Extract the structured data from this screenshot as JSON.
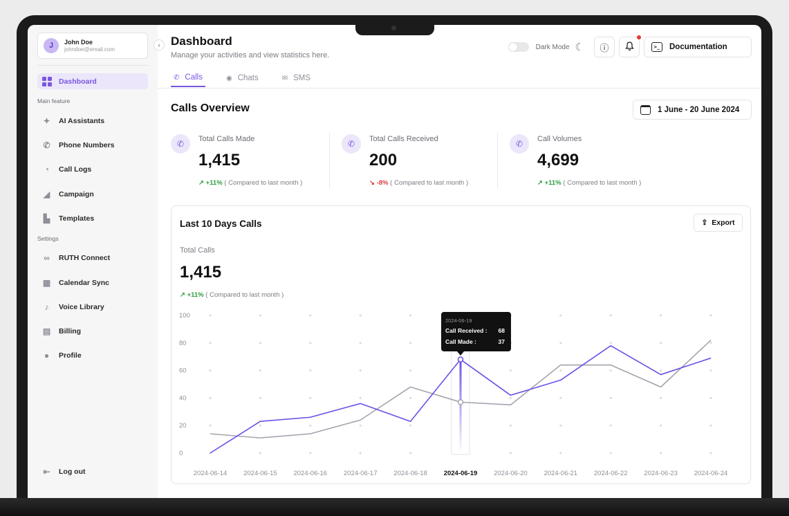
{
  "colors": {
    "accent": "#7a56e0",
    "accent_bg": "#ebe6fa",
    "up": "#2e9e3e",
    "down": "#d93a3a",
    "series_made": "#6c4ee6",
    "series_received": "#a3a3ad"
  },
  "user": {
    "initial": "J",
    "name": "John Doe",
    "email": "johndoe@email.com"
  },
  "sidebar": {
    "dashboard": "Dashboard",
    "main_label": "Main feature",
    "main_items": [
      {
        "label": "AI Assistants",
        "icon": "sparkle-icon"
      },
      {
        "label": "Phone Numbers",
        "icon": "phone-icon"
      },
      {
        "label": "Call Logs",
        "icon": "history-icon"
      },
      {
        "label": "Campaign",
        "icon": "megaphone-icon"
      },
      {
        "label": "Templates",
        "icon": "template-icon"
      }
    ],
    "settings_label": "Settings",
    "settings_items": [
      {
        "label": "RUTH Connect",
        "icon": "link-icon"
      },
      {
        "label": "Calendar Sync",
        "icon": "calendar-icon"
      },
      {
        "label": "Voice Library",
        "icon": "voice-icon"
      },
      {
        "label": "Billing",
        "icon": "billing-icon"
      },
      {
        "label": "Profile",
        "icon": "profile-icon"
      }
    ],
    "logout": "Log out"
  },
  "header": {
    "title": "Dashboard",
    "subtitle": "Manage your activities and view statistics here.",
    "dark_mode": "Dark Mode",
    "documentation": "Documentation"
  },
  "tabs": [
    "Calls",
    "Chats",
    "SMS"
  ],
  "overview": {
    "title": "Calls Overview",
    "date_range": "1 June - 20 June 2024",
    "stats": [
      {
        "label": "Total Calls Made",
        "value": "1,415",
        "change": "+11%",
        "direction": "up",
        "note": "( Compared to last month )"
      },
      {
        "label": "Total Calls Received",
        "value": "200",
        "change": "-8%",
        "direction": "down",
        "note": "( Compared to last month )"
      },
      {
        "label": "Call Volumes",
        "value": "4,699",
        "change": "+11%",
        "direction": "up",
        "note": "( Compared to last month )"
      }
    ]
  },
  "chart_card": {
    "title": "Last 10 Days Calls",
    "export": "Export",
    "total_label": "Total Calls",
    "total_value": "1,415",
    "total_change": "+11%",
    "total_note": "( Compared to last month )"
  },
  "chart_data": {
    "type": "line",
    "x": [
      "2024-06-14",
      "2024-06-15",
      "2024-06-16",
      "2024-06-17",
      "2024-06-18",
      "2024-06-19",
      "2024-06-20",
      "2024-06-21",
      "2024-06-22",
      "2024-06-23",
      "2024-06-24"
    ],
    "ylim": [
      0,
      100
    ],
    "yticks": [
      0,
      20,
      40,
      60,
      80,
      100
    ],
    "grid": "dots",
    "highlight_index": 5,
    "series": [
      {
        "key": "made",
        "values": [
          0,
          23,
          26,
          36,
          23,
          68,
          42,
          53,
          78,
          57,
          69
        ]
      },
      {
        "key": "received",
        "values": [
          14,
          11,
          14,
          24,
          48,
          37,
          35,
          64,
          64,
          48,
          82
        ]
      }
    ],
    "tooltip": {
      "date": "2024-06-19",
      "rows": [
        {
          "label": "Call Received :",
          "value": "68"
        },
        {
          "label": "Call Made :",
          "value": "37"
        }
      ]
    }
  }
}
